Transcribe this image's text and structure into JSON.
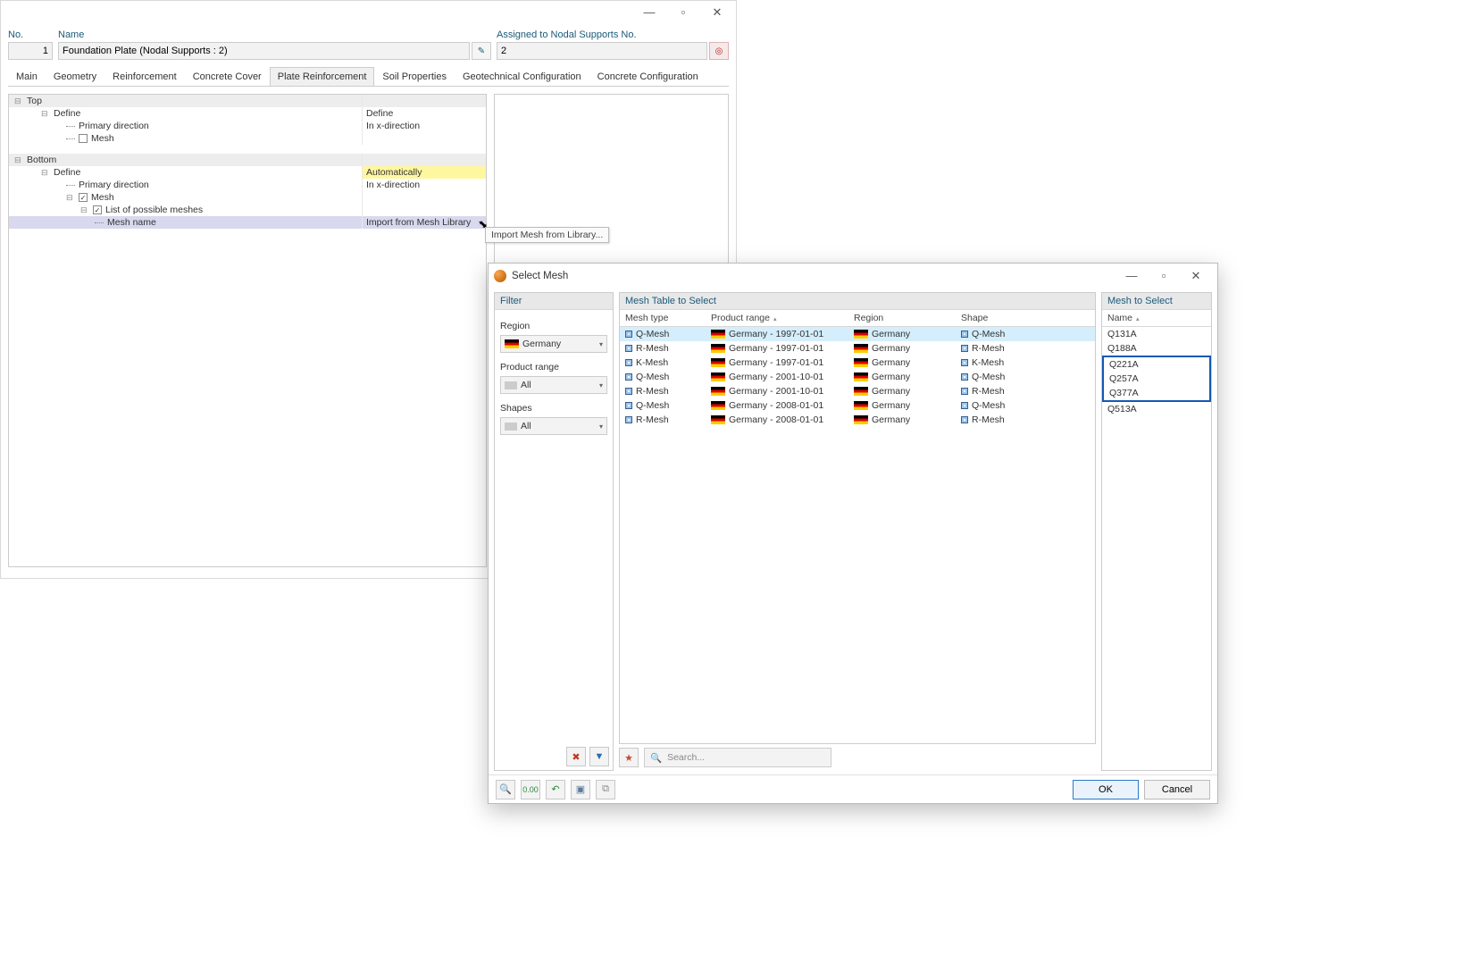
{
  "main": {
    "no_label": "No.",
    "no_value": "1",
    "name_label": "Name",
    "name_value": "Foundation Plate (Nodal Supports : 2)",
    "assigned_label": "Assigned to Nodal Supports No.",
    "assigned_value": "2",
    "tabs": [
      "Main",
      "Geometry",
      "Reinforcement",
      "Concrete Cover",
      "Plate Reinforcement",
      "Soil Properties",
      "Geotechnical Configuration",
      "Concrete Configuration"
    ],
    "active_tab": 4,
    "tree": {
      "top": "Top",
      "define_top": "Define",
      "primary_dir": "Primary direction",
      "in_x": "In x-direction",
      "mesh": "Mesh",
      "bottom": "Bottom",
      "define_bottom": "Define",
      "def_auto": "Automatically",
      "list_possible": "List of possible meshes",
      "mesh_name": "Mesh name",
      "import_lib": "Import from Mesh Library"
    },
    "tooltip": "Import Mesh from Library..."
  },
  "dlg": {
    "title": "Select Mesh",
    "filter_hdr": "Filter",
    "region_lbl": "Region",
    "region_val": "Germany",
    "prodrange_lbl": "Product range",
    "prodrange_val": "All",
    "shapes_lbl": "Shapes",
    "shapes_val": "All",
    "table_hdr": "Mesh Table to Select",
    "list_hdr": "Mesh to Select",
    "cols": {
      "type": "Mesh type",
      "prod": "Product range",
      "region": "Region",
      "shape": "Shape",
      "name": "Name"
    },
    "rows": [
      {
        "type": "Q-Mesh",
        "prod": "Germany - 1997-01-01",
        "region": "Germany",
        "shape": "Q-Mesh"
      },
      {
        "type": "R-Mesh",
        "prod": "Germany - 1997-01-01",
        "region": "Germany",
        "shape": "R-Mesh"
      },
      {
        "type": "K-Mesh",
        "prod": "Germany - 1997-01-01",
        "region": "Germany",
        "shape": "K-Mesh"
      },
      {
        "type": "Q-Mesh",
        "prod": "Germany - 2001-10-01",
        "region": "Germany",
        "shape": "Q-Mesh"
      },
      {
        "type": "R-Mesh",
        "prod": "Germany - 2001-10-01",
        "region": "Germany",
        "shape": "R-Mesh"
      },
      {
        "type": "Q-Mesh",
        "prod": "Germany - 2008-01-01",
        "region": "Germany",
        "shape": "Q-Mesh"
      },
      {
        "type": "R-Mesh",
        "prod": "Germany - 2008-01-01",
        "region": "Germany",
        "shape": "R-Mesh"
      }
    ],
    "selected_row": 0,
    "names": [
      "Q131A",
      "Q188A",
      "Q221A",
      "Q257A",
      "Q377A",
      "Q513A"
    ],
    "names_sel_start": 2,
    "names_sel_end": 4,
    "search_placeholder": "Search...",
    "ok": "OK",
    "cancel": "Cancel"
  }
}
